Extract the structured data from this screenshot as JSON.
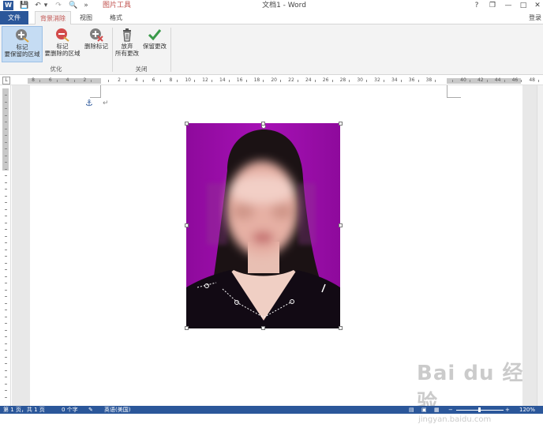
{
  "titlebar": {
    "app_icon": "W",
    "quick_access": {
      "save_icon": "💾",
      "undo_icon": "↶",
      "undo_dropdown": "▾",
      "redo_icon": "↷",
      "print_preview_icon": "🔍",
      "customize_icon": "»"
    },
    "context_tab_header": "图片工具",
    "document_title": "文档1 - Word",
    "help": "?",
    "ribbon_options": "❐",
    "minimize": "—",
    "maximize": "□",
    "close": "✕"
  },
  "tabs": {
    "file": "文件",
    "background_removal": "背景消除",
    "view": "视图",
    "format": "格式",
    "login": "登录"
  },
  "ribbon": {
    "groups": {
      "refine": "优化",
      "close": "关闭"
    },
    "mark_keep_line1": "标记",
    "mark_keep_line2": "要保留的区域",
    "mark_remove_line1": "标记",
    "mark_remove_line2": "要删除的区域",
    "delete_mark": "删除标记",
    "discard_line1": "放弃",
    "discard_line2": "所有更改",
    "keep_changes": "保留更改"
  },
  "ruler": {
    "corner_label": "L",
    "horizontal_labels": [
      "8",
      "6",
      "4",
      "2",
      "",
      "2",
      "4",
      "6",
      "8",
      "10",
      "12",
      "14",
      "16",
      "18",
      "20",
      "22",
      "24",
      "26",
      "28",
      "30",
      "32",
      "34",
      "36",
      "38",
      "",
      "40",
      "42",
      "44",
      "46",
      "48"
    ]
  },
  "document": {
    "anchor_icon": "⚓",
    "paragraph_mark": "↵"
  },
  "watermark": {
    "text": "Bai du 经验",
    "url": "jingyan.baidu.com"
  },
  "statusbar": {
    "page": "第 1 页，共 1 页",
    "word_count": "0 个字",
    "language": "英语(美国)",
    "zoom": "120%"
  },
  "colors": {
    "word_blue": "#2b579a",
    "context_red": "#c0504d",
    "photo_background": "#9a0aa6",
    "ribbon_bg": "#f3f3f3"
  }
}
